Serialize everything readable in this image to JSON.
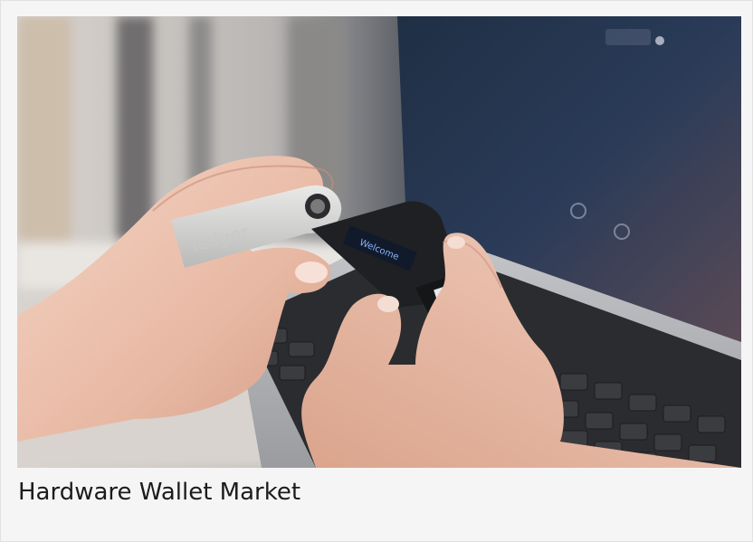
{
  "card": {
    "caption": "Hardware Wallet Market"
  },
  "photo": {
    "device_screen_text": "Welcome",
    "device_brand_text": "ledger"
  }
}
